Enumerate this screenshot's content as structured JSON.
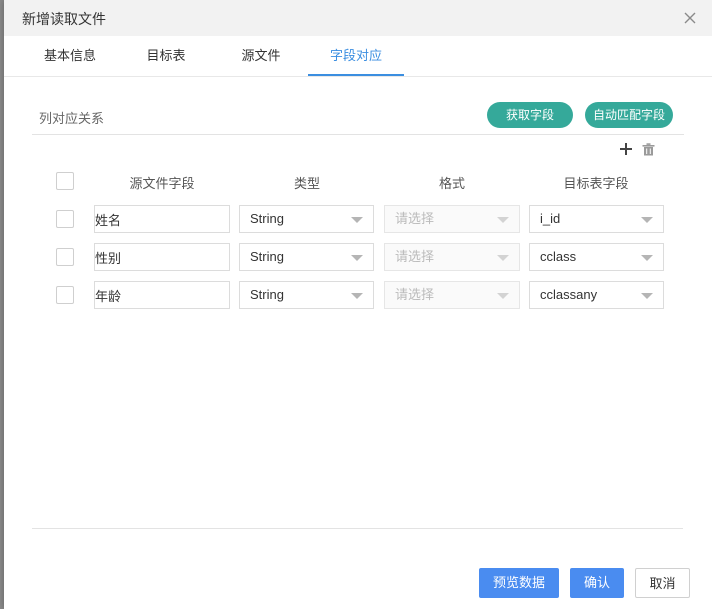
{
  "dialog": {
    "title": "新增读取文件"
  },
  "tabs": [
    {
      "label": "基本信息"
    },
    {
      "label": "目标表"
    },
    {
      "label": "源文件"
    },
    {
      "label": "字段对应"
    }
  ],
  "active_tab": "字段对应",
  "section": {
    "label": "列对应关系",
    "fetch_fields_label": "获取字段",
    "auto_match_label": "自动匹配字段"
  },
  "table": {
    "headers": [
      "源文件字段",
      "类型",
      "格式",
      "目标表字段"
    ],
    "rows": [
      {
        "source": "姓名",
        "type": "String",
        "format_placeholder": "请选择",
        "target": "i_id"
      },
      {
        "source": "性别",
        "type": "String",
        "format_placeholder": "请选择",
        "target": "cclass"
      },
      {
        "source": "年龄",
        "type": "String",
        "format_placeholder": "请选择",
        "target": "cclassany"
      }
    ]
  },
  "footer": {
    "preview_label": "预览数据",
    "confirm_label": "确认",
    "cancel_label": "取消"
  },
  "colors": {
    "accent": "#3b8ee0",
    "teal": "#35a99a",
    "primary_button": "#4a8cf0"
  }
}
